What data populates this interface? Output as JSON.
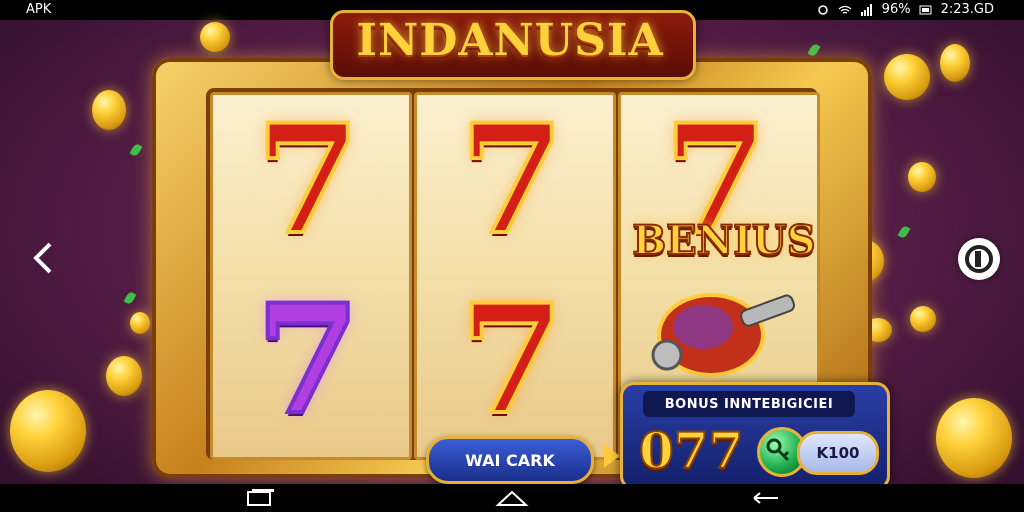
{
  "status_bar": {
    "app_label": "APK",
    "battery": "96%",
    "clock": "2:23.GD"
  },
  "game": {
    "title": "INDANUSIA",
    "bonus_banner": "BENIUS",
    "spin_button_label": "WAI CARK",
    "bonus_panel": {
      "label": "BONUS INNTEBIGICIEI",
      "value": "077",
      "bet_label": "K100"
    }
  },
  "reels": [
    {
      "top": "7",
      "bottom": "7",
      "top_color": "red",
      "bottom_color": "purple"
    },
    {
      "top": "7",
      "bottom": "7",
      "top_color": "red",
      "bottom_color": "red"
    },
    {
      "top": "7",
      "bottom": "",
      "top_color": "red",
      "bottom_symbol": "golden-cannon-icon"
    }
  ],
  "icons": [
    "back-chevron-icon",
    "next-circle-icon",
    "nav-recent-icon",
    "nav-home-icon",
    "nav-back-icon",
    "key-icon",
    "cannon-icon",
    "coin-icon"
  ],
  "colors": {
    "gold": "#ffd13a",
    "red_seven": "#d41f16",
    "purple_seven": "#b13ee0",
    "panel_blue": "#1b2f8a"
  }
}
